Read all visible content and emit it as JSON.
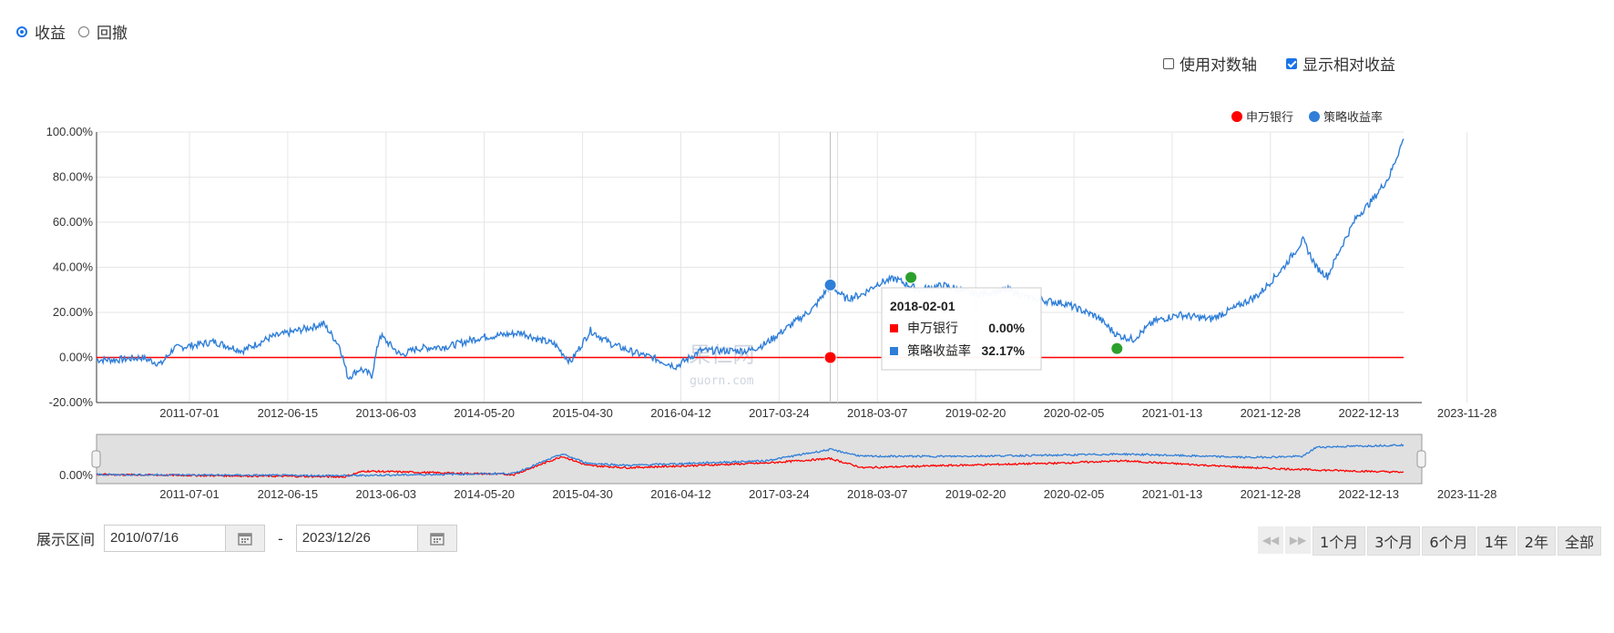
{
  "top_controls": {
    "mode_options": [
      {
        "label": "收益",
        "selected": true
      },
      {
        "label": "回撤",
        "selected": false
      }
    ],
    "checkboxes": [
      {
        "label": "使用对数轴",
        "checked": false
      },
      {
        "label": "显示相对收益",
        "checked": true
      }
    ]
  },
  "chart_data": {
    "type": "line",
    "title": "",
    "xlabel": "",
    "ylabel": "",
    "x_range": [
      "2010-07-16",
      "2023-12-26"
    ],
    "ylim": [
      -20,
      100
    ],
    "y_tick_labels": [
      "100.00%",
      "80.00%",
      "60.00%",
      "40.00%",
      "20.00%",
      "0.00%",
      "-20.00%"
    ],
    "x_tick_labels": [
      "2011-07-01",
      "2012-06-15",
      "2013-06-03",
      "2014-05-20",
      "2015-04-30",
      "2016-04-12",
      "2017-03-24",
      "2018-03-07",
      "2019-02-20",
      "2020-02-05",
      "2021-01-13",
      "2021-12-28",
      "2022-12-13",
      "2023-11-28"
    ],
    "legend_position": "top-right",
    "grid": true,
    "series": [
      {
        "name": "申万银行",
        "color": "#ff0000",
        "points": [
          [
            "2010-07-16",
            0
          ],
          [
            "2023-12-26",
            0
          ]
        ]
      },
      {
        "name": "策略收益率",
        "color": "#2f7ed8",
        "points": [
          [
            "2010-07-16",
            -1
          ],
          [
            "2010-10-01",
            -1
          ],
          [
            "2011-01-01",
            0
          ],
          [
            "2011-03-15",
            -3
          ],
          [
            "2011-05-01",
            4
          ],
          [
            "2011-10-01",
            7
          ],
          [
            "2012-01-15",
            3
          ],
          [
            "2012-05-01",
            9
          ],
          [
            "2012-09-15",
            13
          ],
          [
            "2012-11-15",
            15
          ],
          [
            "2013-01-15",
            5
          ],
          [
            "2013-02-15",
            -9
          ],
          [
            "2013-04-01",
            -5
          ],
          [
            "2013-05-15",
            -8
          ],
          [
            "2013-06-15",
            10
          ],
          [
            "2013-09-01",
            1
          ],
          [
            "2013-11-01",
            4
          ],
          [
            "2014-03-01",
            5
          ],
          [
            "2014-07-01",
            9
          ],
          [
            "2014-12-01",
            11
          ],
          [
            "2015-02-01",
            8
          ],
          [
            "2015-04-01",
            6
          ],
          [
            "2015-06-01",
            -2
          ],
          [
            "2015-08-15",
            12
          ],
          [
            "2015-11-01",
            6
          ],
          [
            "2016-02-01",
            2
          ],
          [
            "2016-04-01",
            0
          ],
          [
            "2016-07-01",
            -4
          ],
          [
            "2016-10-01",
            3
          ],
          [
            "2017-01-01",
            3
          ],
          [
            "2017-04-01",
            3
          ],
          [
            "2017-06-01",
            6
          ],
          [
            "2017-09-01",
            14
          ],
          [
            "2017-12-01",
            22
          ],
          [
            "2018-02-01",
            32.17
          ],
          [
            "2018-04-01",
            26
          ],
          [
            "2018-06-01",
            28
          ],
          [
            "2018-08-01",
            33
          ],
          [
            "2018-10-01",
            35
          ],
          [
            "2019-01-01",
            30
          ],
          [
            "2019-04-01",
            32
          ],
          [
            "2019-08-01",
            28
          ],
          [
            "2019-12-01",
            30
          ],
          [
            "2020-03-01",
            26
          ],
          [
            "2020-07-01",
            24
          ],
          [
            "2020-11-01",
            18
          ],
          [
            "2021-01-13",
            10
          ],
          [
            "2021-03-15",
            8
          ],
          [
            "2021-06-01",
            16
          ],
          [
            "2021-09-01",
            19
          ],
          [
            "2022-01-01",
            17
          ],
          [
            "2022-04-01",
            22
          ],
          [
            "2022-07-01",
            28
          ],
          [
            "2022-10-01",
            40
          ],
          [
            "2022-12-13",
            52
          ],
          [
            "2023-02-01",
            40
          ],
          [
            "2023-03-15",
            36
          ],
          [
            "2023-05-01",
            48
          ],
          [
            "2023-07-01",
            62
          ],
          [
            "2023-09-01",
            70
          ],
          [
            "2023-11-01",
            80
          ],
          [
            "2023-12-26",
            97
          ]
        ]
      }
    ],
    "markers": [
      {
        "date": "2018-02-01",
        "series": "策略收益率",
        "value": 32.17,
        "color": "#2f7ed8"
      },
      {
        "date": "2018-02-01",
        "series": "申万银行",
        "value": 0,
        "color": "#ff0000"
      },
      {
        "date": "2018-12-01",
        "series": "策略收益率",
        "value": 35.5,
        "color": "#2ca02c"
      },
      {
        "date": "2021-01-13",
        "series": "策略收益率",
        "value": 4,
        "color": "#2ca02c"
      }
    ],
    "tooltip": {
      "date": "2018-02-01",
      "rows": [
        {
          "name": "申万银行",
          "value": "0.00%",
          "color": "#ff0000"
        },
        {
          "name": "策略收益率",
          "value": "32.17%",
          "color": "#2f7ed8"
        }
      ]
    },
    "navigator": {
      "y_tick_label": "0.00%",
      "series": [
        {
          "name": "申万银行",
          "color": "#ff0000",
          "points": [
            [
              "2010-07-16",
              0
            ],
            [
              "2013-02-01",
              -2
            ],
            [
              "2013-04-15",
              3
            ],
            [
              "2014-11-01",
              0
            ],
            [
              "2015-05-01",
              16
            ],
            [
              "2015-08-01",
              8
            ],
            [
              "2016-01-01",
              6
            ],
            [
              "2017-06-01",
              10
            ],
            [
              "2018-02-01",
              14
            ],
            [
              "2018-06-01",
              6
            ],
            [
              "2019-05-01",
              8
            ],
            [
              "2020-06-01",
              10
            ],
            [
              "2021-02-01",
              12
            ],
            [
              "2022-06-01",
              6
            ],
            [
              "2023-02-01",
              4
            ],
            [
              "2023-12-26",
              2
            ]
          ]
        },
        {
          "name": "策略收益率",
          "color": "#2f7ed8",
          "points": [
            [
              "2010-07-16",
              0
            ],
            [
              "2013-02-01",
              -1
            ],
            [
              "2014-11-01",
              1
            ],
            [
              "2015-05-01",
              18
            ],
            [
              "2015-08-01",
              10
            ],
            [
              "2016-01-01",
              8
            ],
            [
              "2017-06-01",
              12
            ],
            [
              "2018-02-01",
              22
            ],
            [
              "2018-06-01",
              16
            ],
            [
              "2019-05-01",
              16
            ],
            [
              "2020-06-01",
              17
            ],
            [
              "2021-02-01",
              18
            ],
            [
              "2022-06-01",
              15
            ],
            [
              "2022-12-13",
              16
            ],
            [
              "2023-02-01",
              24
            ],
            [
              "2023-12-26",
              26
            ]
          ]
        }
      ]
    },
    "watermark": {
      "line1": "果仁网",
      "line2": "guorn.com"
    }
  },
  "date_range": {
    "label": "展示区间",
    "start": "2010/07/16",
    "separator": "-",
    "end": "2023/12/26"
  },
  "range_buttons": [
    "1个月",
    "3个月",
    "6个月",
    "1年",
    "2年",
    "全部"
  ]
}
